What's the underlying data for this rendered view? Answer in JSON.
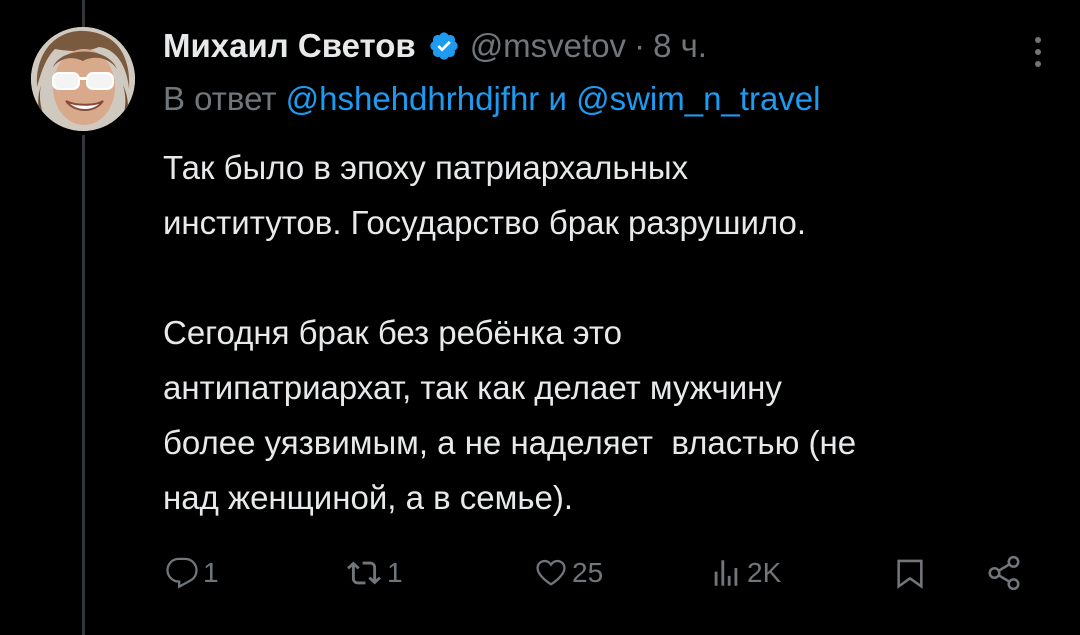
{
  "tweet": {
    "author_name": "Михаил Светов",
    "handle": "@msvetov",
    "separator": "·",
    "time": "8 ч.",
    "reply_prefix": "В ответ",
    "reply_user1": "@hshehdhrhdjfhr",
    "reply_conjunction": "и",
    "reply_user2": "@swim_n_travel",
    "text": "Так было в эпоху патриархальных\nинститутов. Государство брак разрушило.\n\nСегодня брак без ребёнка это\nантипатриархат, так как делает мужчину\nболее уязвимым, а не наделяет  властью (не\nнад женщиной, а в семье)."
  },
  "actions": {
    "replies": "1",
    "retweets": "1",
    "likes": "25",
    "views": "2K"
  },
  "icons": {
    "verified": "verified-badge-icon",
    "more": "more-vertical-icon",
    "reply": "reply-icon",
    "retweet": "retweet-icon",
    "like": "heart-icon",
    "views": "views-icon",
    "bookmark": "bookmark-icon",
    "share": "share-icon"
  },
  "colors": {
    "background": "#000000",
    "text": "#e7e9ea",
    "muted": "#71767b",
    "link": "#1d9bf0"
  }
}
